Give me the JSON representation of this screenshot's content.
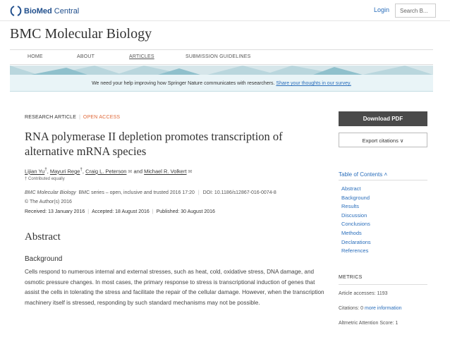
{
  "header": {
    "brand_bold": "BioMed",
    "brand_rest": " Central",
    "login": "Login",
    "search_placeholder": "Search B..."
  },
  "journal_title": "BMC Molecular Biology",
  "nav": [
    "HOME",
    "ABOUT",
    "ARTICLES",
    "SUBMISSION GUIDELINES"
  ],
  "nav_active": "ARTICLES",
  "survey": {
    "text": "We need your help improving how Springer Nature communicates with researchers.",
    "link": "Share your thoughts in our survey."
  },
  "article": {
    "type": "RESEARCH ARTICLE",
    "access": "OPEN ACCESS",
    "title": "RNA polymerase II depletion promotes transcription of alternative mRNA species",
    "authors": [
      {
        "name": "Lijian Yu",
        "mark": "†"
      },
      {
        "name": "Mayuri Rege",
        "mark": "†"
      },
      {
        "name": "Craig L. Peterson",
        "mark": "✉"
      },
      {
        "name": "Michael R. Volkert",
        "mark": "✉"
      }
    ],
    "authors_and": "and",
    "contributed": "† Contributed equally",
    "citation_journal": "BMC Molecular Biology",
    "citation_rest": "BMC series – open, inclusive and trusted 2016 17:20",
    "doi": "DOI: 10.1186/s12867-016-0074-8",
    "copyright": "© The Author(s) 2016",
    "received": "Received: 13 January 2016",
    "accepted": "Accepted: 18 August 2016",
    "published": "Published: 30 August 2016",
    "abstract_heading": "Abstract",
    "background_heading": "Background",
    "background_text": "Cells respond to numerous internal and external stresses, such as heat, cold, oxidative stress, DNA damage, and osmotic pressure changes. In most cases, the primary response to stress is transcriptional induction of genes that assist the cells in tolerating the stress and facilitate the repair of the cellular damage. However, when the transcription machinery itself is stressed, responding by such standard mechanisms may not be possible."
  },
  "sidebar": {
    "download": "Download PDF",
    "export": "Export citations ∨",
    "toc_heading": "Table of Contents ˄",
    "toc": [
      "Abstract",
      "Background",
      "Results",
      "Discussion",
      "Conclusions",
      "Methods",
      "Declarations",
      "References"
    ],
    "metrics_heading": "METRICS",
    "accesses": "Article accesses: 1193",
    "citations_prefix": "Citations: 0",
    "citations_link": "more information",
    "altmetric": "Altmetric Attention Score: 1"
  },
  "colors": {
    "link": "#2a6ebb",
    "open_access": "#e06a3b",
    "download_bg": "#4a4a4a"
  }
}
